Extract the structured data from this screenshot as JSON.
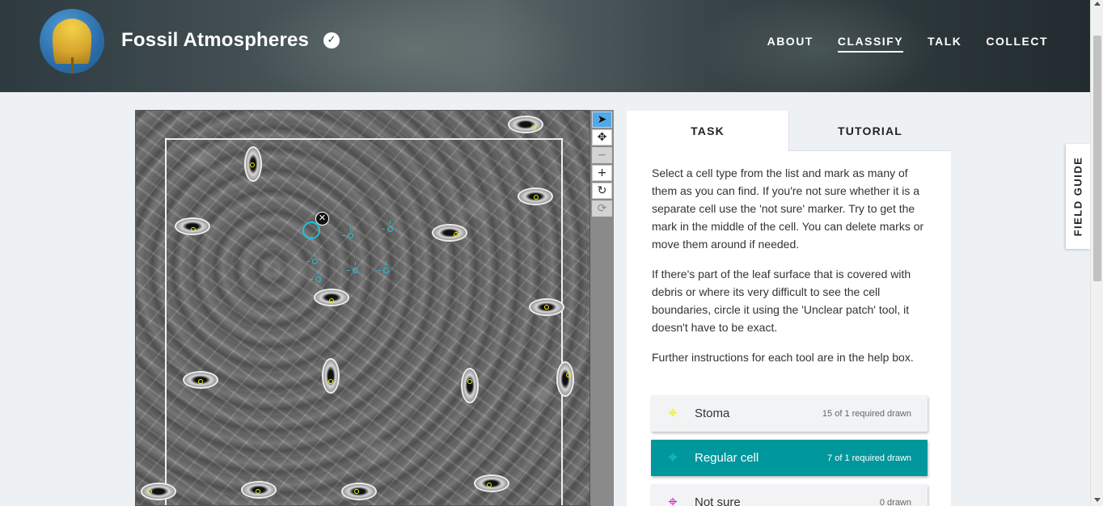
{
  "header": {
    "title": "Fossil Atmospheres",
    "verified_icon": "check-circle-icon",
    "nav": [
      {
        "label": "ABOUT",
        "active": false
      },
      {
        "label": "CLASSIFY",
        "active": true
      },
      {
        "label": "TALK",
        "active": false
      },
      {
        "label": "COLLECT",
        "active": false
      }
    ]
  },
  "toolbar": {
    "tools": [
      "pointer-icon",
      "pan-icon",
      "zoom-out-icon",
      "zoom-in-icon",
      "rotate-icon",
      "reset-icon"
    ]
  },
  "panel": {
    "tabs": [
      {
        "label": "TASK",
        "active": true
      },
      {
        "label": "TUTORIAL",
        "active": false
      }
    ],
    "instructions": [
      "Select a cell type from the list and mark as many of them as you can find. If you're not sure whether it is a separate cell use the 'not sure' marker. Try to get the mark in the middle of the cell. You can delete marks or move them around if needed.",
      "If there's part of the leaf surface that is covered with debris or where its very difficult to see the cell boundaries, circle it using the 'Unclear patch' tool, it doesn't have to be exact.",
      "Further instructions for each tool are in the help box."
    ],
    "tools": [
      {
        "label": "Stoma",
        "count": "15 of 1 required drawn",
        "color": "#e8e838",
        "selected": false
      },
      {
        "label": "Regular cell",
        "count": "7 of 1 required drawn",
        "color": "#19c6d6",
        "selected": true
      },
      {
        "label": "Not sure",
        "count": "0 drawn",
        "color": "#d020c0",
        "selected": false
      }
    ]
  },
  "field_guide": {
    "label": "FIELD GUIDE"
  },
  "colors": {
    "accent": "#00979d",
    "regular_cell": "#19c6d6",
    "stoma": "#f2f20a"
  }
}
